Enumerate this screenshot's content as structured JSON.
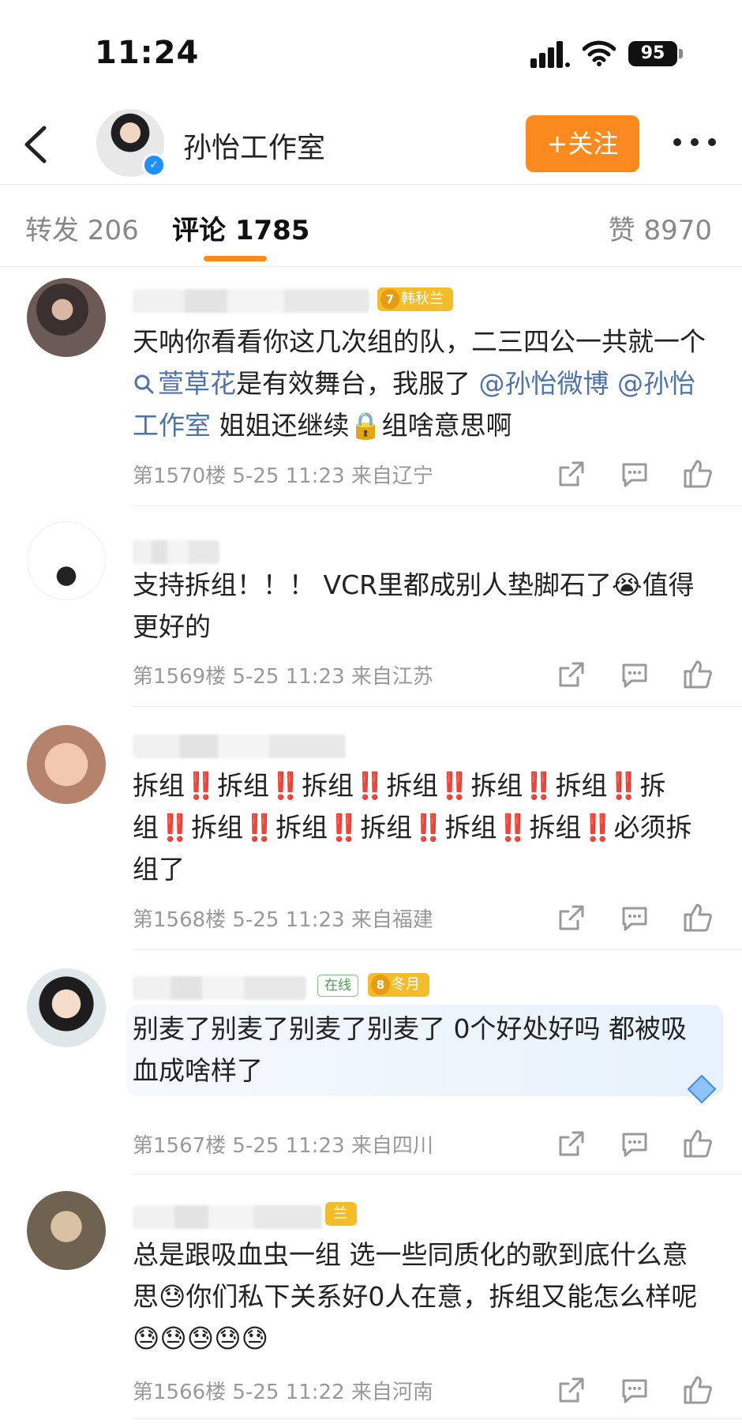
{
  "status": {
    "time": "11:24",
    "battery": "95"
  },
  "header": {
    "account_name": "孙怡工作室",
    "follow_label": "+关注"
  },
  "tabs": {
    "repost": "转发 206",
    "comments": "评论 1785",
    "likes": "赞 8970"
  },
  "colors": {
    "accent": "#fb8a1e",
    "link": "#4e73a8",
    "badge_gold": "#f3bd2a",
    "meta_gray": "#999999"
  },
  "comments": [
    {
      "badge": "韩秋兰",
      "badge_level": "7",
      "text": [
        {
          "t": "天呐你看看你这几次组的队，二三四公一共就一个"
        },
        {
          "t": "萱草花",
          "link": true,
          "search": true
        },
        {
          "t": "是有效舞台，我服了 "
        },
        {
          "t": "@孙怡微博",
          "link": true
        },
        {
          "t": " "
        },
        {
          "t": "@孙怡工作室",
          "link": true
        },
        {
          "t": " 姐姐还继续🔒组啥意思啊"
        }
      ],
      "meta": "第1570楼 5-25 11:23 来自辽宁"
    },
    {
      "text": [
        {
          "t": "支持拆组！！！ VCR里都成别人垫脚石了😭值得更好的"
        }
      ],
      "meta": "第1569楼 5-25 11:23 来自江苏"
    },
    {
      "text": [
        {
          "t": "拆组‼️拆组‼️拆组‼️拆组‼️拆组‼️拆组‼️拆组‼️拆组‼️拆组‼️拆组‼️拆组‼️拆组‼️必须拆组了"
        }
      ],
      "meta": "第1568楼 5-25 11:23 来自福建"
    },
    {
      "online": "在线",
      "badge": "冬月",
      "badge_level": "8",
      "text": [
        {
          "t": "别麦了别麦了别麦了别麦了 0个好处好吗 都被吸血成啥样了"
        }
      ],
      "meta": "第1567楼 5-25 11:23 来自四川"
    },
    {
      "badge": "兰",
      "text": [
        {
          "t": "总是跟吸血虫一组 选一些同质化的歌到底什么意思😓你们私下关系好0人在意，拆组又能怎么样呢😓😓😓😓😓"
        }
      ],
      "meta": "第1566楼 5-25 11:22 来自河南"
    }
  ]
}
